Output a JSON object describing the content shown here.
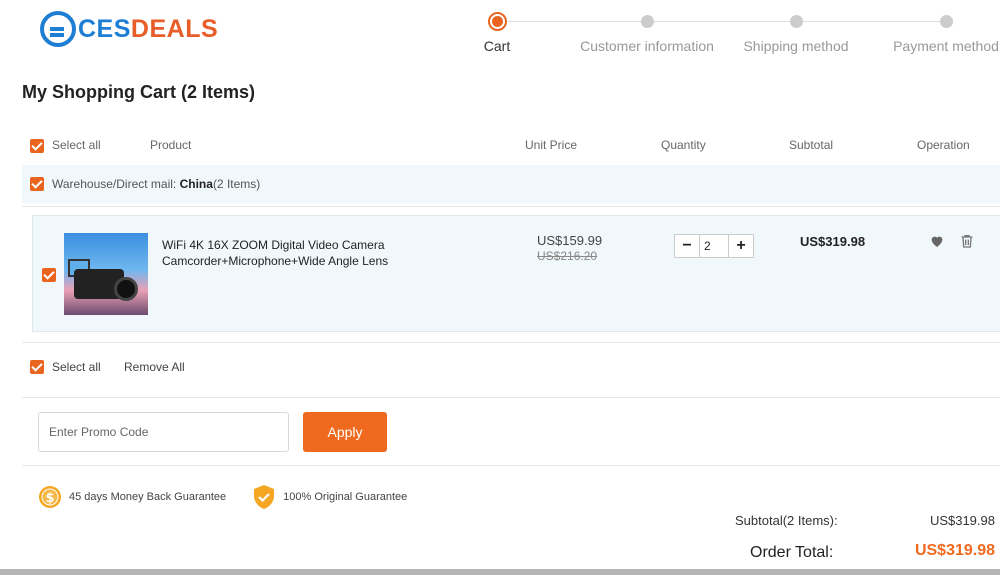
{
  "brand": {
    "ces": "CES",
    "deals": "DEALS"
  },
  "steps": [
    {
      "label": "Cart",
      "active": true
    },
    {
      "label": "Customer information"
    },
    {
      "label": "Shipping method"
    },
    {
      "label": "Payment method"
    }
  ],
  "page_title": "My Shopping Cart (2 Items)",
  "table_header": {
    "select_all": "Select all",
    "product": "Product",
    "unit_price": "Unit Price",
    "quantity": "Quantity",
    "subtotal": "Subtotal",
    "operation": "Operation"
  },
  "warehouse": {
    "prefix": "Warehouse/Direct mail: ",
    "name": "China",
    "count": "(2 Items)"
  },
  "items": [
    {
      "name": "WiFi 4K 16X ZOOM Digital Video Camera Camcorder+Microphone+Wide Angle Lens",
      "price": "US$159.99",
      "old_price": "US$216.20",
      "quantity": "2",
      "subtotal": "US$319.98"
    }
  ],
  "footer": {
    "select_all": "Select all",
    "remove_all": "Remove All"
  },
  "promo": {
    "placeholder": "Enter Promo Code",
    "apply": "Apply"
  },
  "guarantees": [
    "45 days Money Back Guarantee",
    "100% Original Guarantee"
  ],
  "totals": {
    "subtotal_label": "Subtotal(2 Items):",
    "subtotal_value": "US$319.98",
    "order_label": "Order Total:",
    "order_value": "US$319.98"
  },
  "colors": {
    "accent": "#ef6a1f",
    "brand_blue": "#1e7ed3",
    "row_bg": "#f0f8fb"
  }
}
